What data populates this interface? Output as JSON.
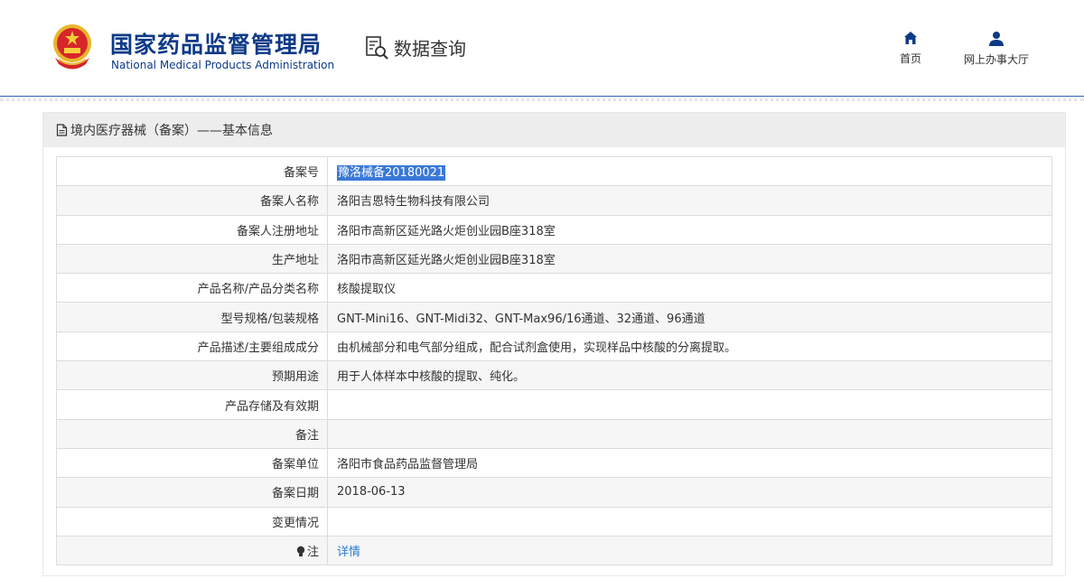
{
  "header": {
    "logo_cn": "国家药品监督管理局",
    "logo_en": "National Medical Products Administration",
    "emblem_icon": "national-emblem-icon",
    "sub_title": "数据查询",
    "nav": [
      {
        "label": "首页",
        "icon": "home-icon"
      },
      {
        "label": "网上办事大厅",
        "icon": "user-icon"
      }
    ]
  },
  "panel": {
    "title": "境内医疗器械（备案）——基本信息",
    "rows": [
      {
        "label": "备案号",
        "value": "豫洛械备20180021"
      },
      {
        "label": "备案人名称",
        "value": "洛阳吉恩特生物科技有限公司"
      },
      {
        "label": "备案人注册地址",
        "value": "洛阳市高新区延光路火炬创业园B座318室"
      },
      {
        "label": "生产地址",
        "value": "洛阳市高新区延光路火炬创业园B座318室"
      },
      {
        "label": "产品名称/产品分类名称",
        "value": "核酸提取仪"
      },
      {
        "label": "型号规格/包装规格",
        "value": "GNT-Mini16、GNT-Midi32、GNT-Max96/16通道、32通道、96通道"
      },
      {
        "label": "产品描述/主要组成成分",
        "value": "由机械部分和电气部分组成，配合试剂盒使用，实现样品中核酸的分离提取。"
      },
      {
        "label": "预期用途",
        "value": "用于人体样本中核酸的提取、纯化。"
      },
      {
        "label": "产品存储及有效期",
        "value": ""
      },
      {
        "label": "备注",
        "value": ""
      },
      {
        "label": "备案单位",
        "value": "洛阳市食品药品监督管理局"
      },
      {
        "label": "备案日期",
        "value": "2018-06-13"
      },
      {
        "label": "变更情况",
        "value": ""
      },
      {
        "label": "注",
        "value": "详情"
      }
    ]
  },
  "colors": {
    "brand_blue": "#0d3a87",
    "selection": "#3a79d8",
    "link": "#2b7bd6"
  }
}
